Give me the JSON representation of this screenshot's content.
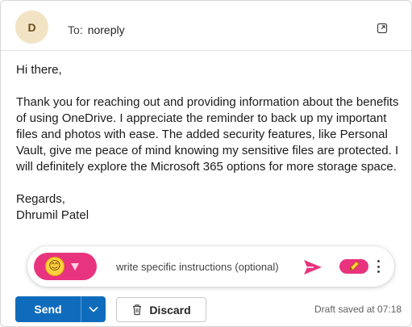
{
  "header": {
    "avatar_initial": "D",
    "to_label": "To:",
    "to_value": "noreply",
    "popout_icon": "popout-icon"
  },
  "body": {
    "greeting": "Hi there,",
    "paragraph": "Thank you for reaching out and providing information about the benefits of using OneDrive. I appreciate the reminder to back up my important files and photos with ease. The added security features, like Personal Vault, give me peace of mind knowing my sensitive files are protected. I will definitely explore the Microsoft 365 options for more storage space.",
    "signoff": "Regards,",
    "signature": "Dhrumil Patel"
  },
  "copilot": {
    "tone_emoji": "😊",
    "instructions_placeholder": "write specific instructions (optional)",
    "accent_color": "#e8337f",
    "icons": [
      "smiley-icon",
      "chevron-down-icon",
      "send-arrow-icon",
      "pencil-icon",
      "more-vertical-icon"
    ]
  },
  "footer": {
    "send_label": "Send",
    "discard_label": "Discard",
    "draft_status": "Draft saved at 07:18",
    "primary_color": "#0f6cbd"
  }
}
